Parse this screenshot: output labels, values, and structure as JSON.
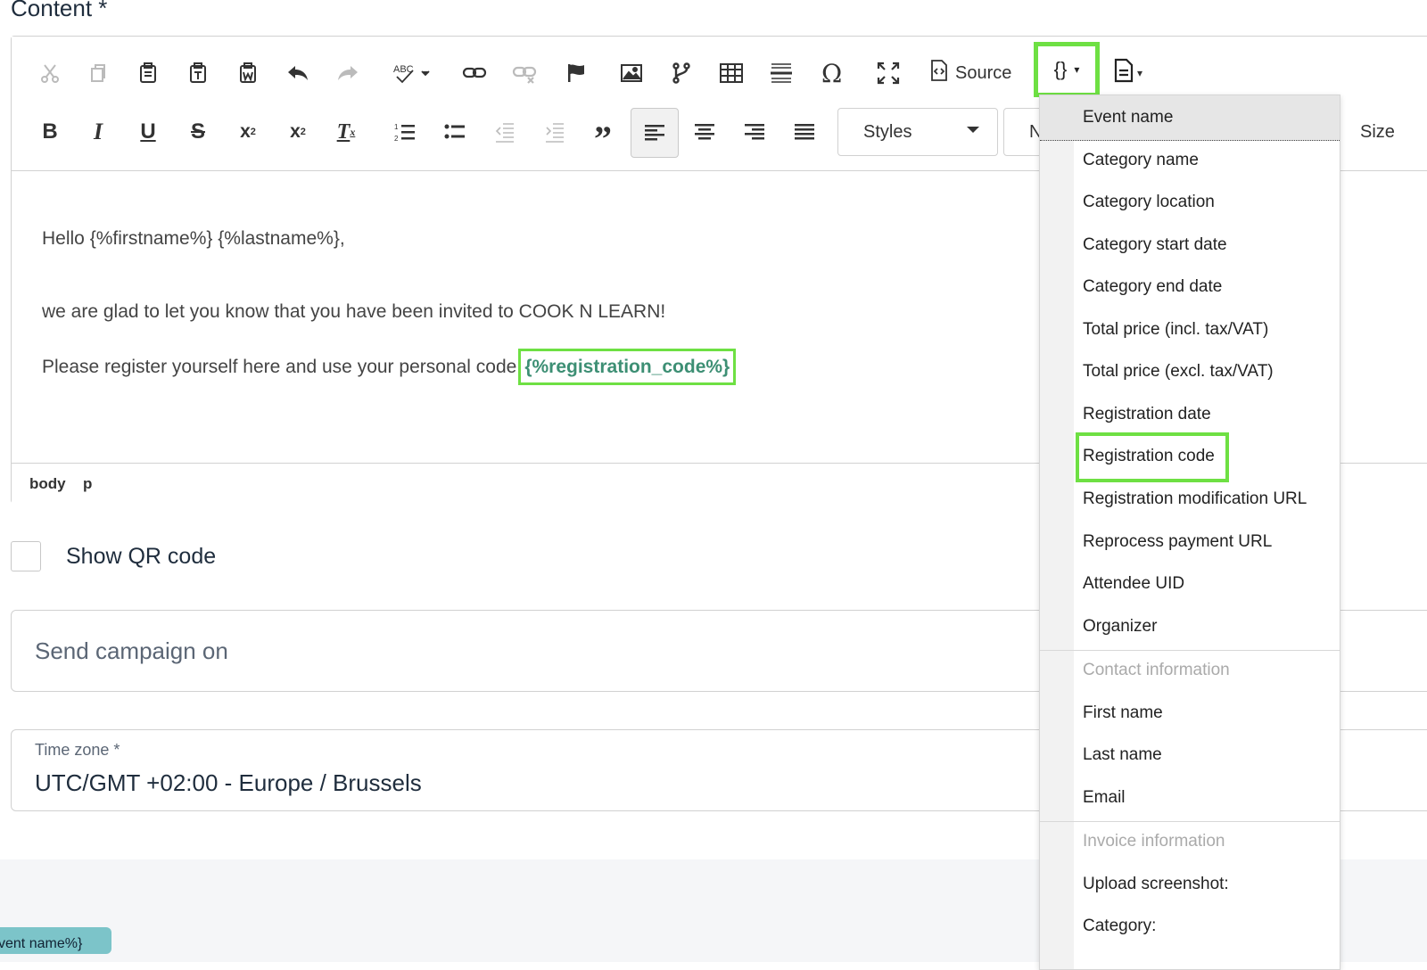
{
  "section_title": "Content *",
  "toolbar": {
    "source_label": "Source",
    "placeholder_glyph": "{}",
    "styles_combo": "Styles",
    "format_combo_partial": "N",
    "size_combo": "Size"
  },
  "content": {
    "greeting": "Hello {%firstname%} {%lastname%},",
    "line_invite": "we are glad to let you know that you have been invited to COOK N LEARN!",
    "line_register": "Please register yourself here and use your personal code",
    "registration_token": "{%registration_code%}"
  },
  "pathbar": {
    "body": "body",
    "p": "p"
  },
  "show_qr": {
    "label": "Show QR code",
    "checked": false
  },
  "send_campaign": {
    "placeholder": "Send campaign on"
  },
  "timezone": {
    "label": "Time zone *",
    "value": "UTC/GMT +02:00 - Europe / Brussels"
  },
  "tag_chip": "vent name%}",
  "dropdown": {
    "items": [
      "Event name",
      "Category name",
      "Category location",
      "Category start date",
      "Category end date",
      "Total price (incl. tax/VAT)",
      "Total price (excl. tax/VAT)",
      "Registration date",
      "Registration code",
      "Registration modification URL",
      "Reprocess payment URL",
      "Attendee UID",
      "Organizer"
    ],
    "contact_header": "Contact information",
    "contact_items": [
      "First name",
      "Last name",
      "Email"
    ],
    "invoice_header": "Invoice information",
    "invoice_items": [
      "Upload screenshot:",
      "Category:"
    ]
  },
  "colors": {
    "highlight": "#6ee043",
    "token_text": "#3d8f74"
  }
}
